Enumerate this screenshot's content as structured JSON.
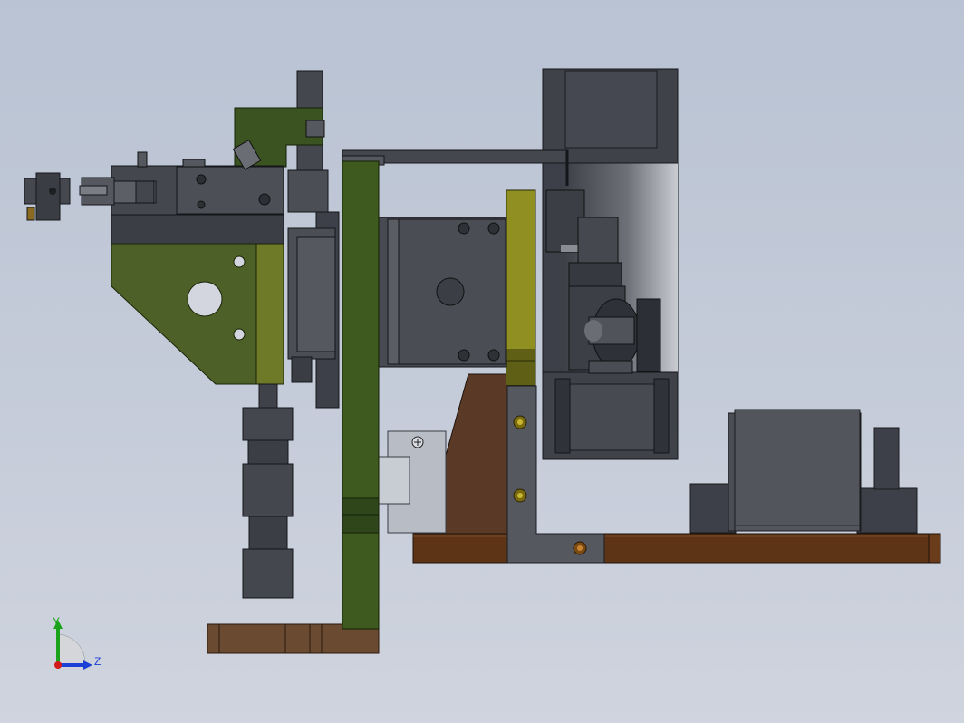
{
  "viewport": {
    "background_top": "#b9c3d3",
    "background_bottom": "#cfd4de"
  },
  "model": {
    "colors": {
      "steel_dark": "#3d4048",
      "steel_mid": "#56595f",
      "steel_light": "#7d8087",
      "green_plate": "#3f5a1f",
      "olive_plate": "#5a6b2c",
      "yellow_plate": "#9a9a2a",
      "wood_base": "#5e3417",
      "bracket_brown": "#5a3a26",
      "rail_light": "#b8bcc4"
    },
    "parts": [
      "gripper-head",
      "cylinder-block",
      "mounting-bracket",
      "vertical-guide-plate",
      "servo-motor",
      "belt-pulley-housing",
      "support-bracket",
      "base-plate",
      "drive-motor-box",
      "lower-cylinder",
      "foot-plate",
      "linear-rail-block"
    ]
  },
  "triad": {
    "y_label": "Y",
    "z_label": "Z",
    "colors": {
      "y": "#1aa31a",
      "z": "#1c3fd6",
      "x": "#d21a1a"
    }
  }
}
